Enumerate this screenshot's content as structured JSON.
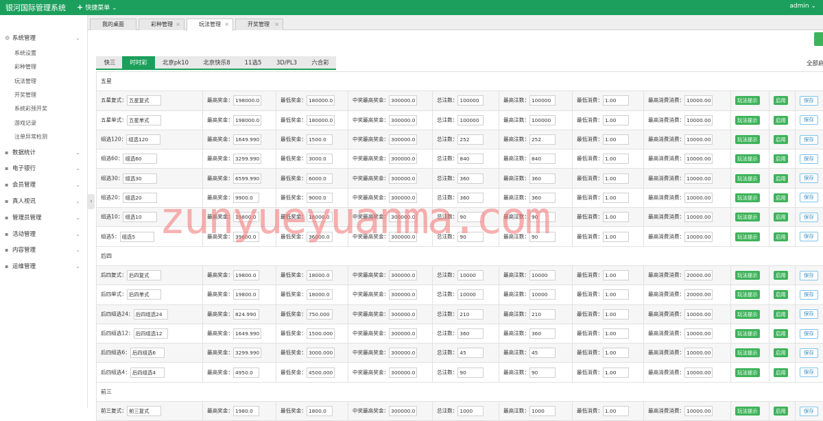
{
  "header": {
    "app_title": "银河国际管理系统",
    "quick_menu": "快捷菜单",
    "user": "admin"
  },
  "sidebar": {
    "groups": [
      {
        "label": "系统管理",
        "icon": "gear-icon",
        "items": [
          "系统设置",
          "彩种管理",
          "玩法管理",
          "开奖管理",
          "系统彩预开奖",
          "游戏记录",
          "注单异常检测"
        ]
      },
      {
        "label": "数据统计",
        "icon": "chart-icon"
      },
      {
        "label": "电子银行",
        "icon": "bank-icon"
      },
      {
        "label": "会员管理",
        "icon": "user-icon"
      },
      {
        "label": "真人视讯",
        "icon": "video-icon"
      },
      {
        "label": "管理员管理",
        "icon": "admin-icon"
      },
      {
        "label": "活动管理",
        "icon": "activity-icon"
      },
      {
        "label": "内容管理",
        "icon": "content-icon"
      },
      {
        "label": "运维管理",
        "icon": "ops-icon"
      }
    ]
  },
  "tabs": [
    {
      "label": "我的桌面",
      "closable": false
    },
    {
      "label": "彩种管理",
      "closable": true
    },
    {
      "label": "玩法管理",
      "closable": true,
      "active": true
    },
    {
      "label": "开奖管理",
      "closable": true
    }
  ],
  "lottery_tabs": [
    "快三",
    "时时彩",
    "北京pk10",
    "北京快乐8",
    "11选5",
    "3D/PL3",
    "六合彩"
  ],
  "lottery_active": "时时彩",
  "all_label": "全部启",
  "field_labels": {
    "max_prize": "最高奖金：",
    "min_prize": "最低奖金：",
    "max_win": "中奖最高奖金：",
    "total_bets": "总注数：",
    "max_bets": "最高注数：",
    "min_spend": "最低消费：",
    "max_spend": "最高消费消费："
  },
  "buttons": {
    "hint": "玩法提示",
    "enable": "启用",
    "save": "保存"
  },
  "groups": [
    {
      "title": "五星",
      "rows": [
        {
          "label": "五星复式：",
          "name": "五星复式",
          "max_prize": "198000.0",
          "min_prize": "180000.0",
          "max_win": "300000.0",
          "total_bets": "100000",
          "max_bets": "100000",
          "min_spend": "1.00",
          "max_spend": "10000.00"
        },
        {
          "label": "五星单式：",
          "name": "五星单式",
          "max_prize": "198000.0",
          "min_prize": "180000.0",
          "max_win": "300000.0",
          "total_bets": "100000",
          "max_bets": "100000",
          "min_spend": "1.00",
          "max_spend": "10000.00"
        },
        {
          "label": "组选120：",
          "name": "组选120",
          "max_prize": "1649.990",
          "min_prize": "1500.0",
          "max_win": "300000.0",
          "total_bets": "252",
          "max_bets": "252",
          "min_spend": "1.00",
          "max_spend": "10000.00"
        },
        {
          "label": "组选60：",
          "name": "组选60",
          "max_prize": "3299.990",
          "min_prize": "3000.0",
          "max_win": "300000.0",
          "total_bets": "840",
          "max_bets": "840",
          "min_spend": "1.00",
          "max_spend": "10000.00"
        },
        {
          "label": "组选30：",
          "name": "组选30",
          "max_prize": "6599.990",
          "min_prize": "6000.0",
          "max_win": "300000.0",
          "total_bets": "360",
          "max_bets": "360",
          "min_spend": "1.00",
          "max_spend": "10000.00"
        },
        {
          "label": "组选20：",
          "name": "组选20",
          "max_prize": "9900.0",
          "min_prize": "9000.0",
          "max_win": "300000.0",
          "total_bets": "360",
          "max_bets": "360",
          "min_spend": "1.00",
          "max_spend": "10000.00"
        },
        {
          "label": "组选10：",
          "name": "组选10",
          "max_prize": "19800.0",
          "min_prize": "18000.0",
          "max_win": "300000.0",
          "total_bets": "90",
          "max_bets": "90",
          "min_spend": "1.00",
          "max_spend": "10000.00"
        },
        {
          "label": "组选5：",
          "name": "组选5",
          "max_prize": "39600.0",
          "min_prize": "36000.0",
          "max_win": "300000.0",
          "total_bets": "90",
          "max_bets": "90",
          "min_spend": "1.00",
          "max_spend": "10000.00"
        }
      ]
    },
    {
      "title": "后四",
      "rows": [
        {
          "label": "后四复式：",
          "name": "后四复式",
          "max_prize": "19800.0",
          "min_prize": "18000.0",
          "max_win": "300000.0",
          "total_bets": "10000",
          "max_bets": "10000",
          "min_spend": "1.00",
          "max_spend": "20000.00"
        },
        {
          "label": "后四单式：",
          "name": "后四单式",
          "max_prize": "19800.0",
          "min_prize": "18000.0",
          "max_win": "300000.0",
          "total_bets": "10000",
          "max_bets": "10000",
          "min_spend": "1.00",
          "max_spend": "20000.00"
        },
        {
          "label": "后四组选24：",
          "name": "后四组选24",
          "max_prize": "824.990",
          "min_prize": "750.000",
          "max_win": "300000.0",
          "total_bets": "210",
          "max_bets": "210",
          "min_spend": "1.00",
          "max_spend": "10000.00"
        },
        {
          "label": "后四组选12：",
          "name": "后四组选12",
          "max_prize": "1649.990",
          "min_prize": "1500.000",
          "max_win": "300000.0",
          "total_bets": "360",
          "max_bets": "360",
          "min_spend": "1.00",
          "max_spend": "10000.00"
        },
        {
          "label": "后四组选6：",
          "name": "后四组选6",
          "max_prize": "3299.990",
          "min_prize": "3000.000",
          "max_win": "300000.0",
          "total_bets": "45",
          "max_bets": "45",
          "min_spend": "1.00",
          "max_spend": "10000.00"
        },
        {
          "label": "后四组选4：",
          "name": "后四组选4",
          "max_prize": "4950.0",
          "min_prize": "4500.000",
          "max_win": "300000.0",
          "total_bets": "90",
          "max_bets": "90",
          "min_spend": "1.00",
          "max_spend": "10000.00"
        }
      ]
    },
    {
      "title": "前三",
      "rows": [
        {
          "label": "前三复式：",
          "name": "前三复式",
          "max_prize": "1980.0",
          "min_prize": "1800.0",
          "max_win": "300000.0",
          "total_bets": "1000",
          "max_bets": "1000",
          "min_spend": "1.00",
          "max_spend": "10000.00"
        }
      ]
    }
  ],
  "watermark": "zunyueyuanma.com",
  "colors": {
    "brand": "#1c9f5c",
    "button_green": "#3db35a",
    "save_border": "#7fc3e6",
    "watermark": "#f47878"
  }
}
